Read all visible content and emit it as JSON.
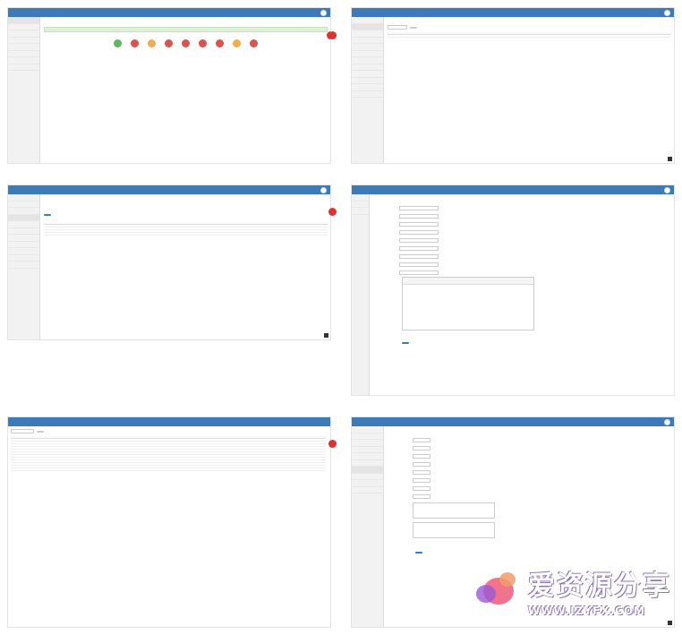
{
  "watermark": {
    "name": "爱资源分享",
    "url": "WWW.IZYFX.COM",
    "colors": {
      "pink": "#ee5a7a",
      "purple": "#9b59d6",
      "orange": "#f39c6b"
    }
  },
  "colors": {
    "brand": "#3d7ab8",
    "accent_red": "#e0302f"
  }
}
